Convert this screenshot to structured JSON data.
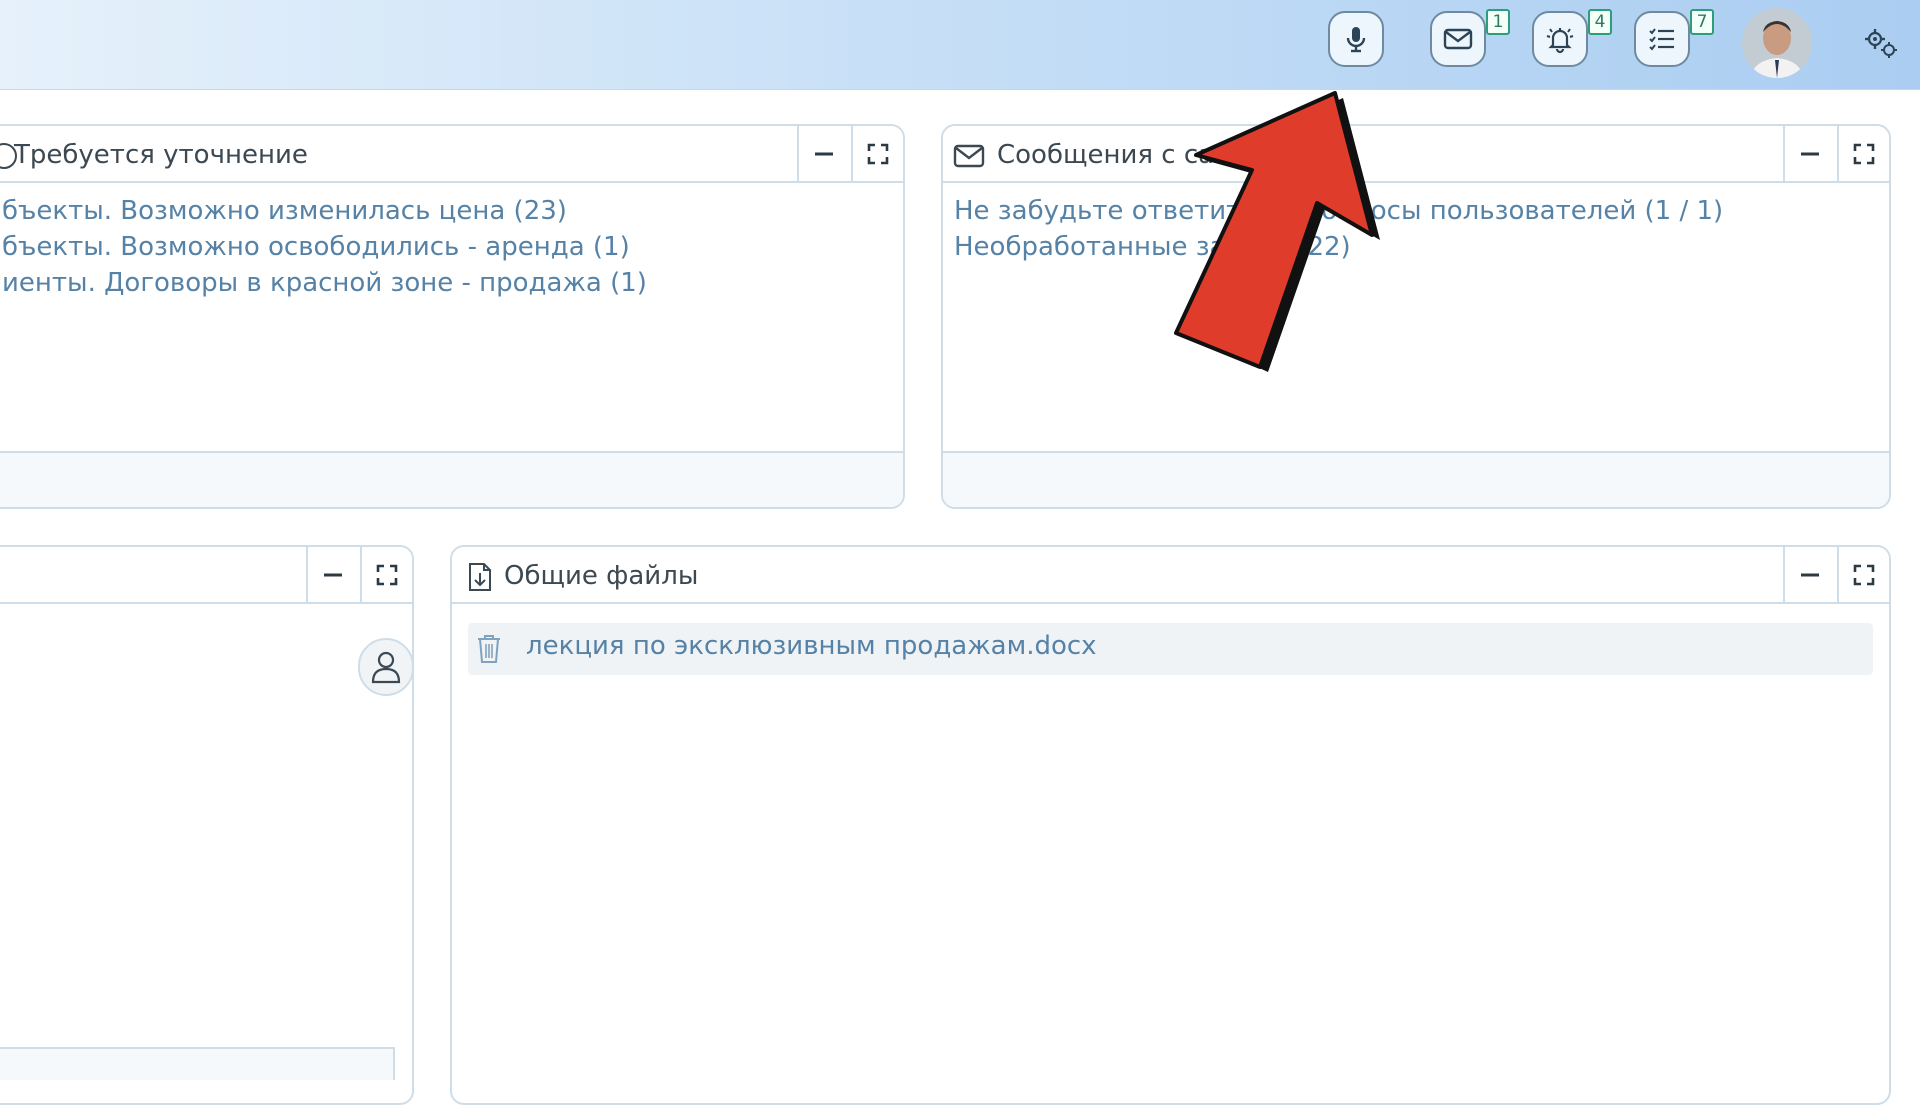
{
  "topbar": {
    "buttons": [
      {
        "name": "microphone-icon"
      },
      {
        "name": "mail-icon",
        "badge": "1"
      },
      {
        "name": "bell-icon",
        "badge": "4"
      },
      {
        "name": "tasks-icon",
        "badge": "7"
      }
    ],
    "avatar": "avatar",
    "settings_icon": "gears-icon"
  },
  "panels": {
    "clarify": {
      "title": "Требуется уточнение",
      "items": [
        "бъекты. Возможно изменилась цена (23)",
        "бъекты. Возможно освободились - аренда (1)",
        "иенты. Договоры в красной зоне - продажа (1)"
      ]
    },
    "messages": {
      "title": "Сообщения с сайта",
      "items": [
        "Не забудьте ответить на вопросы пользователей (1 / 1)",
        "Необработанные заявки (22)"
      ]
    },
    "files": {
      "title": "Общие файлы",
      "items": [
        "лекция по эксклюзивным продажам.docx"
      ]
    }
  },
  "colors": {
    "accent": "#5582a6",
    "badge": "#2e9e78",
    "arrow": "#e03c2c",
    "border": "#cfdde8"
  }
}
